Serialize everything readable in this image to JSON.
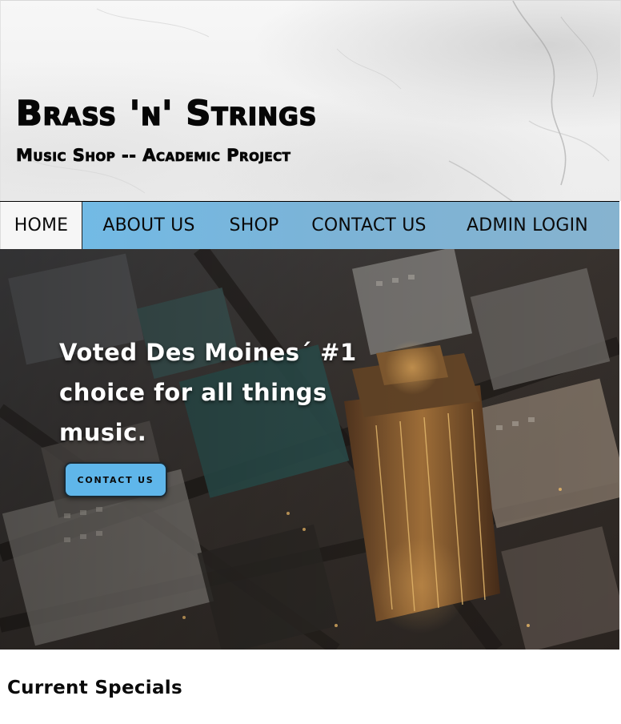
{
  "header": {
    "title": "Brass 'n' Strings",
    "subtitle": "Music Shop -- Academic Project"
  },
  "nav": {
    "items": [
      {
        "label": "HOME",
        "active": true
      },
      {
        "label": "ABOUT US",
        "active": false
      },
      {
        "label": "SHOP",
        "active": false
      },
      {
        "label": "CONTACT US",
        "active": false
      },
      {
        "label": "ADMIN LOGIN",
        "active": false
      }
    ]
  },
  "hero": {
    "headline": "Voted Des Moines´ #1 choice for all things music.",
    "button_label": "contact us"
  },
  "specials": {
    "heading": "Current Specials"
  },
  "colors": {
    "nav_background": "#7cb3d6",
    "nav_active_background": "#f6f6f6",
    "button_background": "#5fb6ea",
    "text_dark": "#060606",
    "hero_text": "#ffffff"
  }
}
